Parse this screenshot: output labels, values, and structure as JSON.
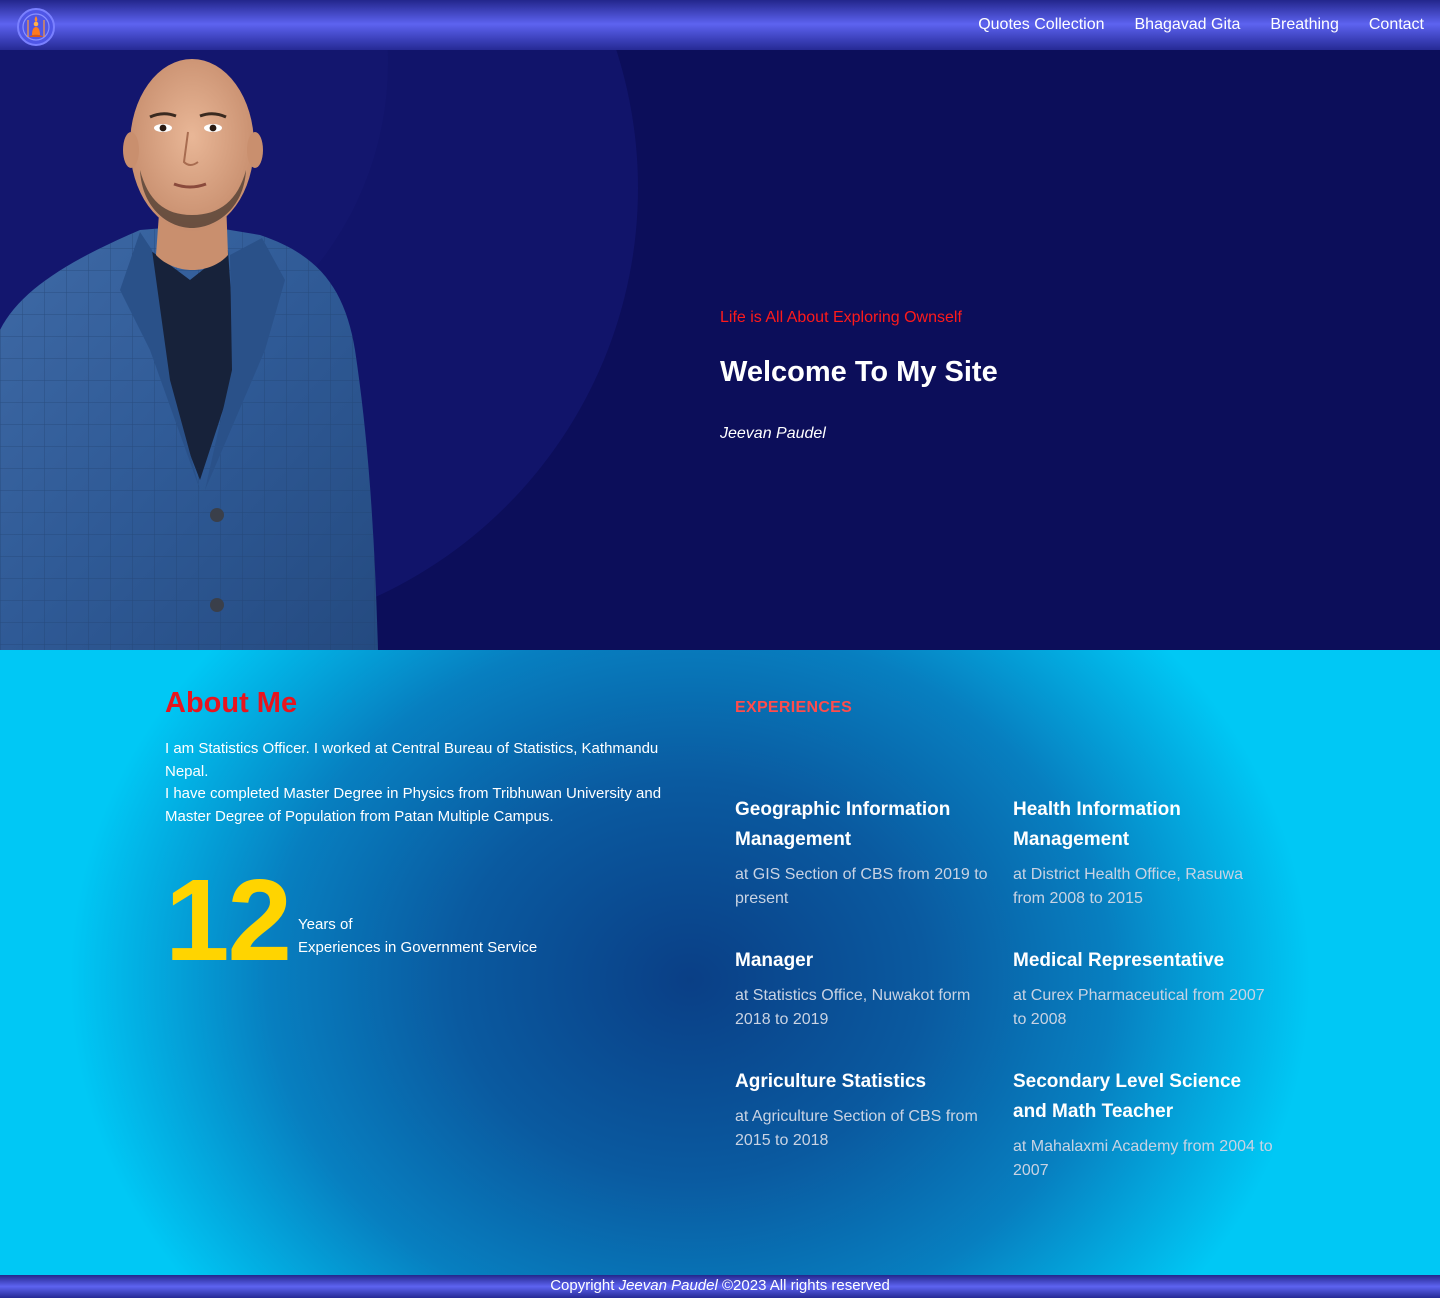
{
  "nav": {
    "logo_icon": "meditation-logo-icon",
    "links": [
      "Quotes Collection",
      "Bhagavad Gita",
      "Breathing",
      "Contact"
    ]
  },
  "hero": {
    "subtitle": "Life is All About Exploring Ownself",
    "title": "Welcome To My Site",
    "name": "Jeevan Paudel"
  },
  "about": {
    "title": "About Me",
    "paragraph_1": "I am Statistics Officer. I worked at Central Bureau of Statistics, Kathmandu Nepal.",
    "paragraph_2": "I have completed Master Degree in Physics from Tribhuwan University and Master Degree of Population from Patan Multiple Campus.",
    "years_number": "12",
    "years_line_1": "Years of",
    "years_line_2": "Experiences in Government Service"
  },
  "experiences": {
    "heading": "EXPERIENCES",
    "items": [
      {
        "title": "Geographic Information Management",
        "detail": "at GIS Section of CBS from 2019 to present"
      },
      {
        "title": "Health Information Management",
        "detail": "at District Health Office, Rasuwa from 2008 to 2015"
      },
      {
        "title": "Manager",
        "detail": "at Statistics Office, Nuwakot form 2018 to 2019"
      },
      {
        "title": "Medical Representative",
        "detail": "at Curex Pharmaceutical from 2007 to 2008"
      },
      {
        "title": "Agriculture Statistics",
        "detail": "at Agriculture Section of CBS from 2015 to 2018"
      },
      {
        "title": "Secondary Level Science and Math Teacher",
        "detail": "at Mahalaxmi Academy from 2004 to 2007"
      }
    ]
  },
  "footer": {
    "prefix": "Copyright",
    "name": "Jeevan Paudel",
    "suffix": "©2023 All rights reserved"
  },
  "colors": {
    "hero_bg": "#0c0e5a",
    "accent_red": "#e8141e",
    "number_yellow": "#ffd400",
    "nav_blue": "#5d63f0"
  }
}
